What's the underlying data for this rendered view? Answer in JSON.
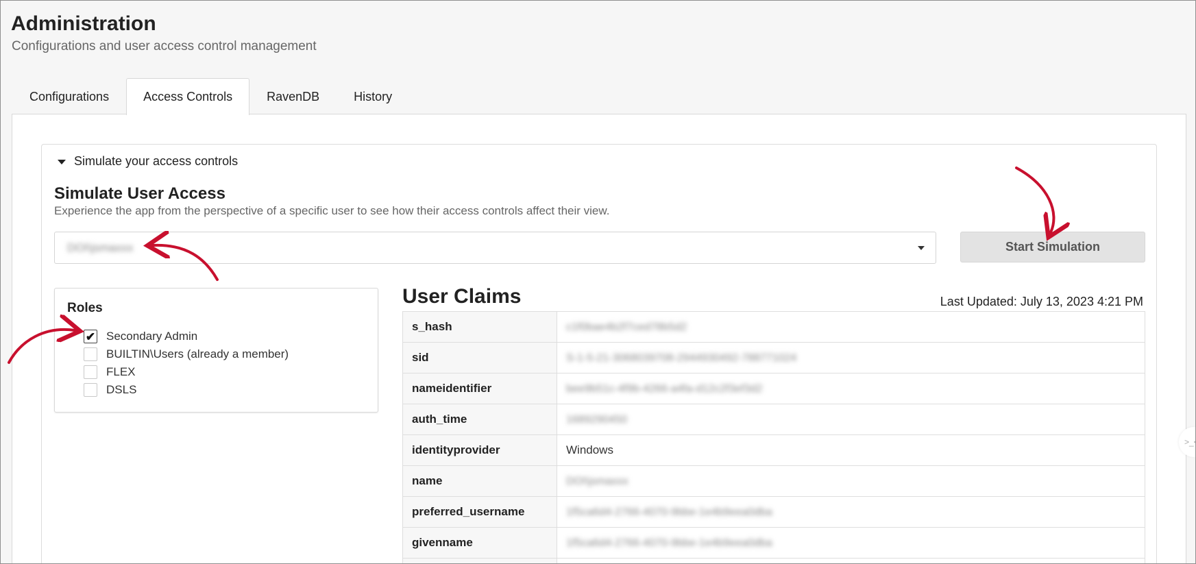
{
  "header": {
    "title": "Administration",
    "subtitle": "Configurations and user access control management"
  },
  "tabs": [
    {
      "label": "Configurations",
      "active": false
    },
    {
      "label": "Access Controls",
      "active": true
    },
    {
      "label": "RavenDB",
      "active": false
    },
    {
      "label": "History",
      "active": false
    }
  ],
  "simulation": {
    "disclosure_label": "Simulate your access controls",
    "title": "Simulate User Access",
    "description": "Experience the app from the perspective of a specific user to see how their access controls affect their view.",
    "selected_user": "DOI\\jsmaxxx",
    "start_button": "Start Simulation"
  },
  "roles": {
    "title": "Roles",
    "items": [
      {
        "label": "Secondary Admin",
        "checked": true
      },
      {
        "label": "BUILTIN\\Users (already a member)",
        "checked": false
      },
      {
        "label": "FLEX",
        "checked": false
      },
      {
        "label": "DSLS",
        "checked": false
      }
    ]
  },
  "claims": {
    "title": "User Claims",
    "last_updated": "Last Updated: July 13, 2023 4:21 PM",
    "rows": [
      {
        "key": "s_hash",
        "value": "c1f0bae4b2f7ced78b5d2",
        "blurred": true
      },
      {
        "key": "sid",
        "value": "S-1-5-21-3068039708-2944930492-788771024",
        "blurred": true
      },
      {
        "key": "nameidentifier",
        "value": "bee9b51c-4f9b-4266-a4fa-d12c2f3ef3d2",
        "blurred": true
      },
      {
        "key": "auth_time",
        "value": "1689290450",
        "blurred": true
      },
      {
        "key": "identityprovider",
        "value": "Windows",
        "blurred": false
      },
      {
        "key": "name",
        "value": "DOI\\jsmaxxx",
        "blurred": true
      },
      {
        "key": "preferred_username",
        "value": "1f5ca6d4-2766-4070-9bbe-1e4b9eea0dba",
        "blurred": true
      },
      {
        "key": "givenname",
        "value": "1f5ca6d4-2766-4070-9bbe-1e4b9eea0dba",
        "blurred": true
      },
      {
        "key": "",
        "value": "",
        "blurred": false
      }
    ]
  },
  "colors": {
    "annotation_arrow": "#c8102e",
    "panel_background": "#ffffff",
    "page_background": "#f6f6f6",
    "button_background": "#e3e3e3"
  },
  "icons": {
    "disclosure": "caret-down-icon",
    "select": "chevron-down-icon",
    "checkbox_checked": "checkmark-icon",
    "edge_handle": "code-icon"
  },
  "edge_handle_label": ">_<"
}
